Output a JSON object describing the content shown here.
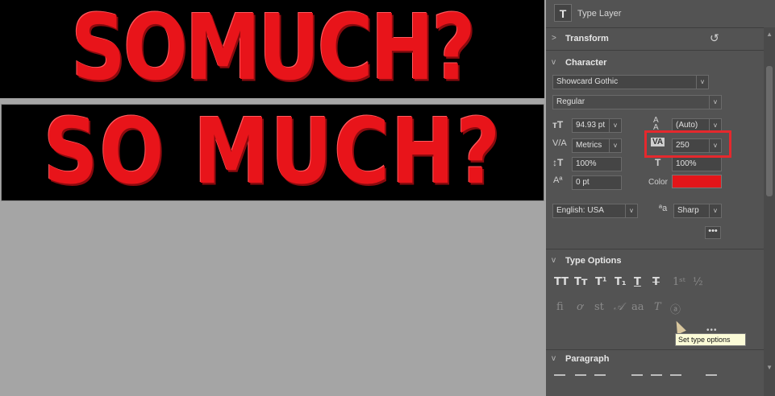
{
  "canvas": {
    "banner1_text": "SOMUCH?",
    "banner2_text": "SO MUCH?",
    "text_color": "#e8141a"
  },
  "panel": {
    "header_label": "Type Layer",
    "transform_title": "Transform",
    "character_title": "Character",
    "font_family": "Showcard Gothic",
    "font_style": "Regular",
    "font_size": "94.93 pt",
    "leading": "(Auto)",
    "kerning": "Metrics",
    "tracking": "250",
    "vertical_scale": "100%",
    "horizontal_scale": "100%",
    "baseline_shift": "0 pt",
    "color_label": "Color",
    "color_value": "#e31519",
    "language": "English: USA",
    "antialias": "Sharp",
    "more_dots": "•••",
    "type_options_title": "Type Options",
    "type_options_more": "•••",
    "paragraph_title": "Paragraph",
    "tooltip": "Set type options"
  },
  "icons": {
    "t_badge": "T",
    "reset": "↺",
    "chev_open": "v",
    "chev_closed": ">"
  }
}
